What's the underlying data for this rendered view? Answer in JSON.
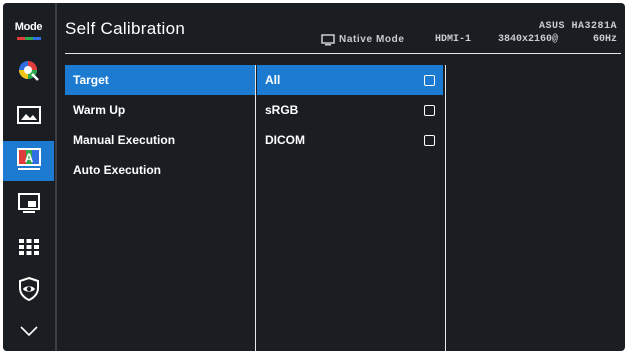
{
  "header": {
    "title": "Self Calibration",
    "model": "ASUS HA3281A",
    "mode": "Native Mode",
    "input": "HDMI-1",
    "resolution": "3840x2160@",
    "refresh": "60Hz"
  },
  "sidebar": {
    "mode_label": "Mode",
    "items": [
      {
        "icon": "mode-icon",
        "active": false
      },
      {
        "icon": "color-wheel-icon",
        "active": false
      },
      {
        "icon": "image-icon",
        "active": false
      },
      {
        "icon": "self-calibration-icon",
        "active": true
      },
      {
        "icon": "pip-icon",
        "active": false
      },
      {
        "icon": "system-grid-icon",
        "active": false
      },
      {
        "icon": "shield-eye-icon",
        "active": false
      },
      {
        "icon": "chevron-down-icon",
        "active": false
      }
    ]
  },
  "menu": {
    "items": [
      {
        "label": "Target",
        "active": true
      },
      {
        "label": "Warm Up",
        "active": false
      },
      {
        "label": "Manual Execution",
        "active": false
      },
      {
        "label": "Auto Execution",
        "active": false
      }
    ]
  },
  "options": {
    "items": [
      {
        "label": "All",
        "active": true,
        "checked": false
      },
      {
        "label": "sRGB",
        "active": false,
        "checked": false
      },
      {
        "label": "DICOM",
        "active": false,
        "checked": false
      }
    ]
  },
  "colors": {
    "background": "#1a1d22",
    "accent": "#1c7bd1",
    "text": "#ffffff"
  }
}
